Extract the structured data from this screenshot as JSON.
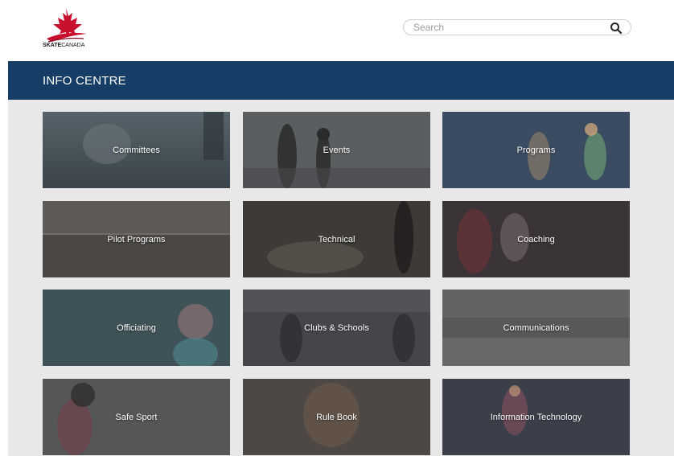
{
  "brand": {
    "logo_text_bold": "SKATE",
    "logo_text_rest": "CANADA",
    "brand_red": "#c8102e",
    "brand_blue": "#163d66"
  },
  "search": {
    "placeholder": "Search",
    "icon": "search-icon"
  },
  "page": {
    "title": "INFO CENTRE"
  },
  "tiles": [
    {
      "label": "Committees"
    },
    {
      "label": "Events"
    },
    {
      "label": "Programs"
    },
    {
      "label": "Pilot Programs"
    },
    {
      "label": "Technical"
    },
    {
      "label": "Coaching"
    },
    {
      "label": "Officiating"
    },
    {
      "label": "Clubs & Schools"
    },
    {
      "label": "Communications"
    },
    {
      "label": "Safe Sport"
    },
    {
      "label": "Rule Book"
    },
    {
      "label": "Information Technology"
    }
  ]
}
